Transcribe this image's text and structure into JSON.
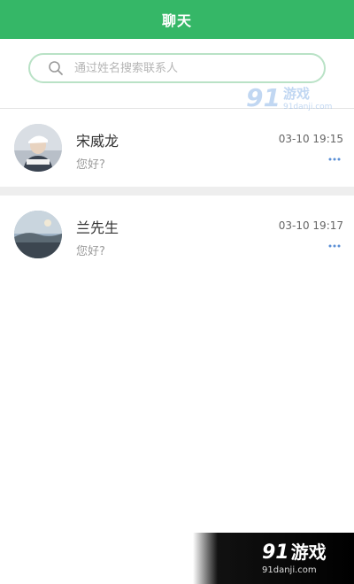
{
  "header": {
    "title": "聊天"
  },
  "search": {
    "placeholder": "通过姓名搜索联系人",
    "value": ""
  },
  "contacts": [
    {
      "name": "宋威龙",
      "message": "您好?",
      "time": "03-10 19:15"
    },
    {
      "name": "兰先生",
      "message": "您好?",
      "time": "03-10 19:17"
    }
  ],
  "watermark": {
    "logo_number": "91",
    "logo_text": "游戏",
    "url": "91danji.com"
  },
  "colors": {
    "header": "#35b767",
    "search_border": "#b9e2c6",
    "more_dots": "#5b8fd6",
    "separator": "#eeeeee"
  },
  "icons": {
    "search": "search-icon",
    "more": "more-dots-icon"
  }
}
